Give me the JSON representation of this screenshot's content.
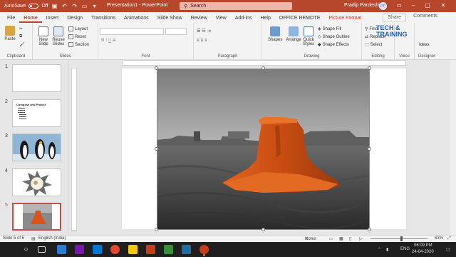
{
  "titlebar": {
    "autosave": "AutoSave",
    "autosave_state": "Off",
    "title": "Presentation1 - PowerPoint",
    "search_placeholder": "Search",
    "user_name": "Pradip Pardeshi",
    "user_initials": "PP"
  },
  "tabs": [
    "File",
    "Home",
    "Insert",
    "Design",
    "Transitions",
    "Animations",
    "Slide Show",
    "Review",
    "View",
    "Add-ins",
    "Help",
    "OFFICE REMOTE",
    "Picture Format"
  ],
  "actions": {
    "share": "Share",
    "comments": "Comments"
  },
  "ribbon": {
    "clipboard": {
      "paste": "Paste",
      "label": "Clipboard"
    },
    "slides": {
      "new_slide": "New Slide",
      "reuse_slides": "Reuse Slides",
      "layout": "Layout",
      "reset": "Reset",
      "section": "Section",
      "label": "Slides"
    },
    "font": {
      "label": "Font"
    },
    "paragraph": {
      "label": "Paragraph"
    },
    "drawing": {
      "shapes": "Shapes",
      "arrange": "Arrange",
      "quick_styles": "Quick Styles",
      "shape_fill": "Shape Fill",
      "shape_outline": "Shape Outline",
      "shape_effects": "Shape Effects",
      "label": "Drawing"
    },
    "editing": {
      "find": "Find",
      "replace": "Replace",
      "select": "Select",
      "label": "Editing"
    },
    "voice": {
      "label": "Voice"
    },
    "designer": {
      "label": "Designer",
      "design_ideas": "Ideas"
    },
    "brand_line1": "TECH &",
    "brand_line2": "TRAINING"
  },
  "slides_pane": {
    "numbers": [
      "1",
      "2",
      "3",
      "4",
      "5"
    ],
    "slide2_title": "Compose and Protect"
  },
  "statusbar": {
    "slide_info": "Slide 5 of 5",
    "language": "English (India)",
    "notes": "Notes",
    "zoom": "63%"
  },
  "taskbar": {
    "lang": "ENG",
    "time": "06:09 PM",
    "date": "24-04-2020"
  },
  "colors": {
    "accent": "#b7472a",
    "rock": "#d9531a"
  }
}
